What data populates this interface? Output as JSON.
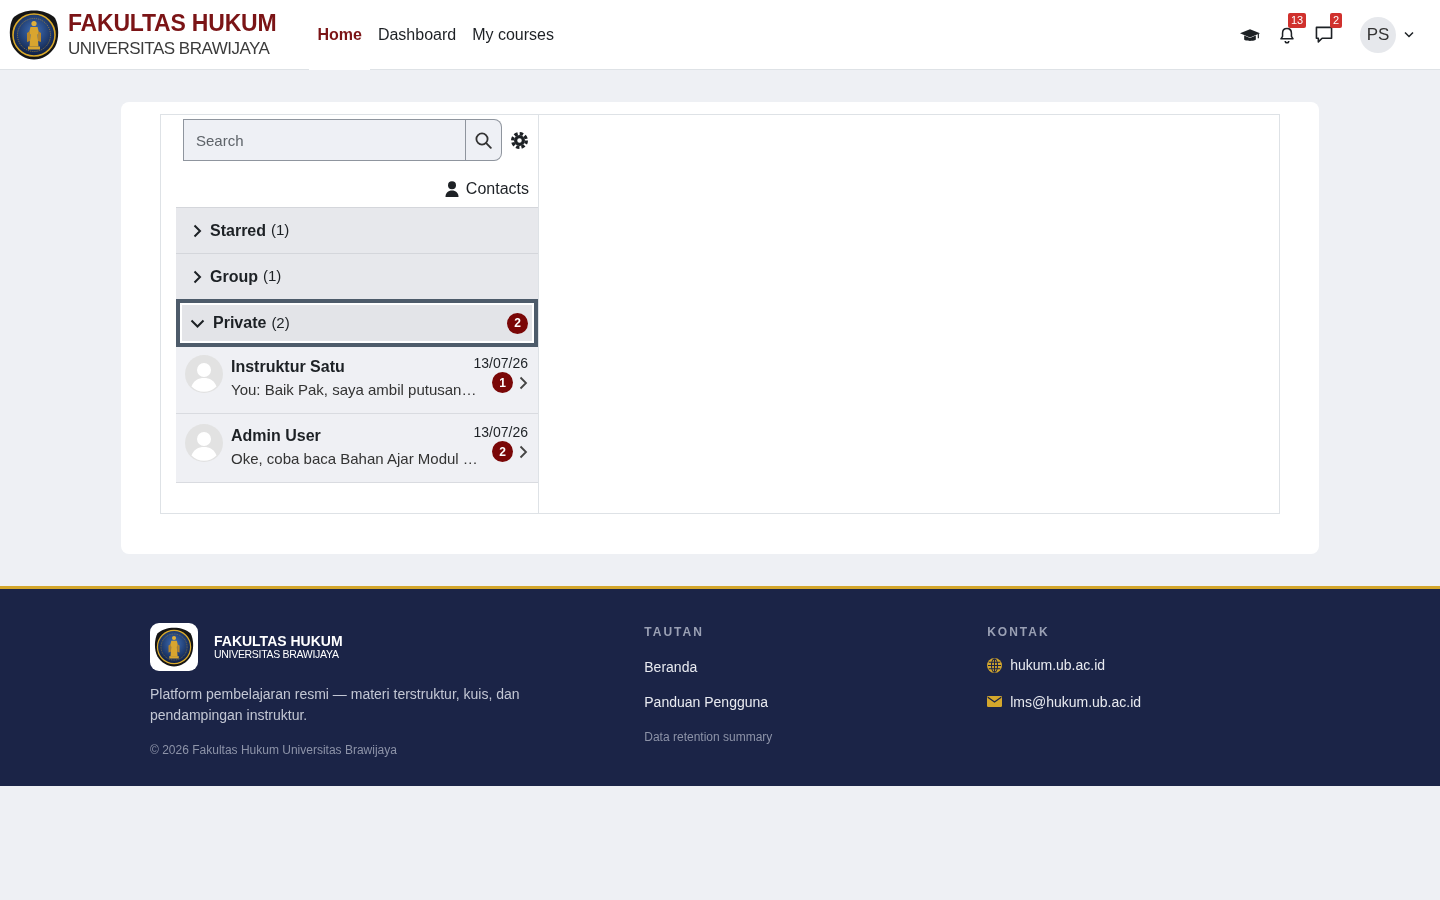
{
  "navbar": {
    "brand": {
      "title": "FAKULTAS HUKUM",
      "subtitle": "UNIVERSITAS BRAWIJAYA"
    },
    "links": [
      {
        "label": "Home",
        "selected": true
      },
      {
        "label": "Dashboard",
        "selected": false
      },
      {
        "label": "My courses",
        "selected": false
      }
    ],
    "notifications_badge": "13",
    "messages_badge": "2",
    "user_initials": "PS"
  },
  "messaging": {
    "search": {
      "placeholder": "Search"
    },
    "contacts_link": "Contacts",
    "sections": [
      {
        "title": "Starred",
        "count": "(1)",
        "expanded": false,
        "focused": false
      },
      {
        "title": "Group",
        "count": "(1)",
        "expanded": false,
        "focused": false
      },
      {
        "title": "Private",
        "count": "(2)",
        "expanded": true,
        "focused": true,
        "unread": "2",
        "conversations": [
          {
            "name": "Instruktur Satu",
            "date": "13/07/26",
            "preview": "You: Baik Pak, saya ambil putusan…",
            "unread": "1"
          },
          {
            "name": "Admin User",
            "date": "13/07/26",
            "preview": "Oke, coba baca Bahan Ajar Modul …",
            "unread": "2"
          }
        ]
      }
    ]
  },
  "footer": {
    "brand": {
      "title": "FAKULTAS HUKUM",
      "subtitle": "UNIVERSITAS BRAWIJAYA"
    },
    "description": "Platform pembelajaran resmi — materi terstruktur, kuis, dan pendampingan instruktur.",
    "copyright": "© 2026 Fakultas Hukum Universitas Brawijaya",
    "links_heading": "TAUTAN",
    "links": [
      "Beranda",
      "Panduan Pengguna"
    ],
    "data_retention_link": "Data retention summary",
    "contact_heading": "KONTAK",
    "contacts": [
      {
        "kind": "website",
        "text": "hukum.ub.ac.id"
      },
      {
        "kind": "email",
        "text": "lms@hukum.ub.ac.id"
      }
    ]
  }
}
